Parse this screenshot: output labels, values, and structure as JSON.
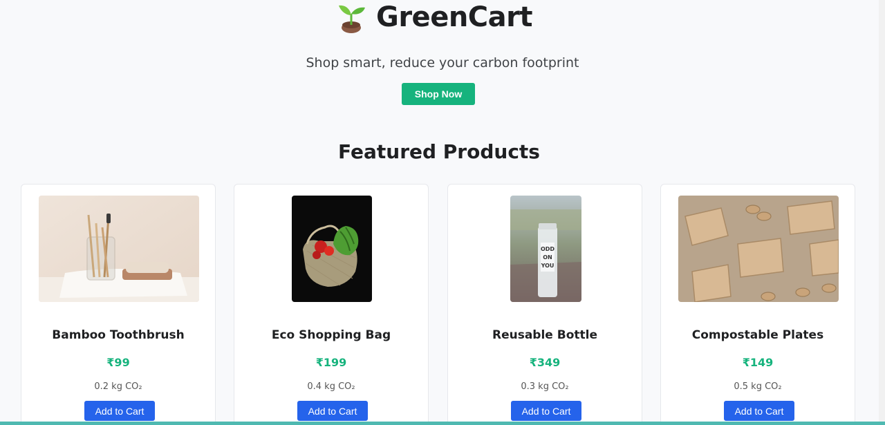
{
  "header": {
    "brand_icon": "seedling-icon",
    "title": "GreenCart",
    "tagline": "Shop smart, reduce your carbon footprint",
    "cta_label": "Shop Now"
  },
  "featured": {
    "title": "Featured Products",
    "products": [
      {
        "name": "Bamboo Toothbrush",
        "price": "₹99",
        "co2": "0.2 kg CO₂",
        "button": "Add to Cart",
        "image": "bamboo-toothbrush-photo"
      },
      {
        "name": "Eco Shopping Bag",
        "price": "₹199",
        "co2": "0.4 kg CO₂",
        "button": "Add to Cart",
        "image": "mesh-bag-photo"
      },
      {
        "name": "Reusable Bottle",
        "price": "₹349",
        "co2": "0.3 kg CO₂",
        "button": "Add to Cart",
        "image": "glass-bottle-photo"
      },
      {
        "name": "Compostable Plates",
        "price": "₹149",
        "co2": "0.5 kg CO₂",
        "button": "Add to Cart",
        "image": "paper-trays-photo"
      }
    ]
  },
  "colors": {
    "accent_green": "#16b37d",
    "button_blue": "#2563eb",
    "background": "#f8f9fb"
  }
}
